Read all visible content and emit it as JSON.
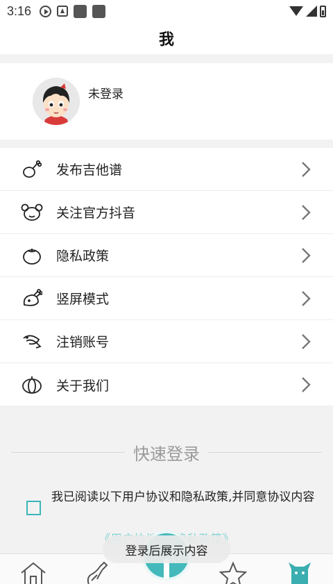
{
  "status_bar": {
    "time": "3:16"
  },
  "header": {
    "title": "我"
  },
  "profile": {
    "login_status": "未登录"
  },
  "menu": {
    "items": [
      {
        "label": "发布吉他谱",
        "icon": "drumstick-icon"
      },
      {
        "label": "关注官方抖音",
        "icon": "mouse-face-icon"
      },
      {
        "label": "隐私政策",
        "icon": "tomato-icon"
      },
      {
        "label": "竖屏模式",
        "icon": "roast-chicken-icon"
      },
      {
        "label": "注销账号",
        "icon": "fish-icon"
      },
      {
        "label": "关于我们",
        "icon": "pumpkin-icon"
      }
    ]
  },
  "quick_login": {
    "heading": "快速登录",
    "agree_text": "我已阅读以下用户协议和隐私政策,并同意协议内容",
    "policy_links": "《用户协议》《隐私政策》"
  },
  "toast": {
    "text": "登录后展示内容"
  },
  "tabs": [
    {
      "icon": "home-icon"
    },
    {
      "icon": "guitar-icon"
    },
    {
      "icon": "add-icon"
    },
    {
      "icon": "star-icon"
    },
    {
      "icon": "cat-icon"
    }
  ],
  "colors": {
    "accent": "#44b9bb",
    "link": "#5fc8c9",
    "background": "#f2f2f2"
  }
}
